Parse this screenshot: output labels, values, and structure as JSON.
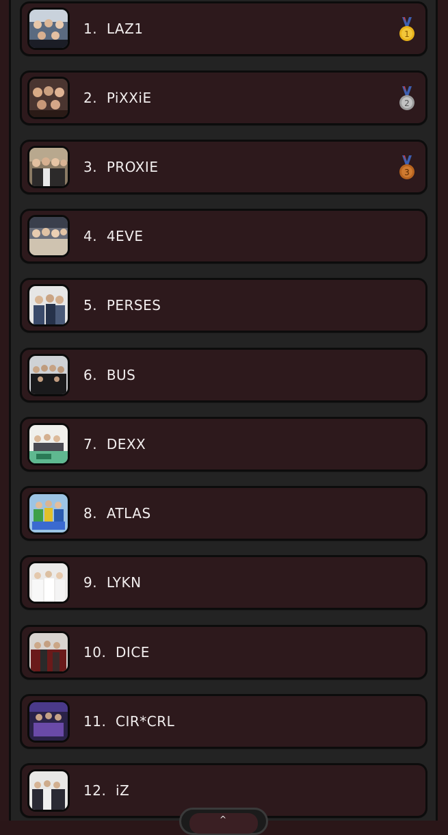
{
  "leaderboard": {
    "items": [
      {
        "rank": "1.",
        "name": "LAZ1",
        "medal": "gold-medal-icon",
        "medal_number": "1"
      },
      {
        "rank": "2.",
        "name": "PiXXiE",
        "medal": "silver-medal-icon",
        "medal_number": "2"
      },
      {
        "rank": "3.",
        "name": "PROXIE",
        "medal": "bronze-medal-icon",
        "medal_number": "3"
      },
      {
        "rank": "4.",
        "name": "4EVE"
      },
      {
        "rank": "5.",
        "name": "PERSES"
      },
      {
        "rank": "6.",
        "name": "BUS"
      },
      {
        "rank": "7.",
        "name": "DEXX"
      },
      {
        "rank": "8.",
        "name": "ATLAS"
      },
      {
        "rank": "9.",
        "name": "LYKN"
      },
      {
        "rank": "10.",
        "name": "DICE"
      },
      {
        "rank": "11.",
        "name": "CIR*CRL"
      },
      {
        "rank": "12.",
        "name": "iZ"
      }
    ]
  },
  "colors": {
    "row_bg": "#2d191c",
    "panel_bg": "#232323",
    "text": "#f2eeee",
    "gold": "#e8b21a",
    "silver": "#b7b7b7",
    "bronze": "#b8641f"
  },
  "bottom_handle": {
    "icon": "chevron-up-icon",
    "glyph": "^"
  }
}
